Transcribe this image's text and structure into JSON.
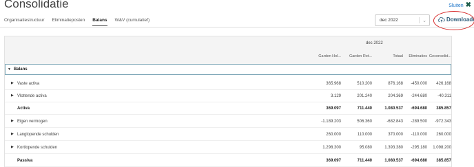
{
  "page": {
    "title": "Consolidatie",
    "close_label": "Sluiten",
    "close_icon": "close-x-icon"
  },
  "tabs": [
    {
      "label": "Organisatiestructuur",
      "active": false
    },
    {
      "label": "Eliminatieposten",
      "active": false
    },
    {
      "label": "Balans",
      "active": true
    },
    {
      "label": "W&V (cumulatief)",
      "active": false
    }
  ],
  "period_select": {
    "value": "dec 2022"
  },
  "download": {
    "label": "Downloaden",
    "icon": "cloud-upload-icon"
  },
  "table": {
    "period_header": "dec 2022",
    "columns": [
      "Garden Hol...",
      "Garden Ret...",
      "Totaal",
      "Eliminaties",
      "Geconsolid..."
    ],
    "group_label": "Balans",
    "rows": [
      {
        "label": "Vaste activa",
        "values": [
          "365.968",
          "510.200",
          "876.168",
          "-450.000",
          "426.168"
        ],
        "expandable": true,
        "total": false
      },
      {
        "label": "Vlottende activa",
        "values": [
          "3.129",
          "201.240",
          "204.369",
          "-244.680",
          "-40.311"
        ],
        "expandable": true,
        "total": false
      },
      {
        "label": "Activa",
        "values": [
          "369.097",
          "711.440",
          "1.080.537",
          "-694.680",
          "385.857"
        ],
        "expandable": false,
        "total": true
      },
      {
        "label": "Eigen vermogen",
        "values": [
          "-1.189.203",
          "506.360",
          "-682.843",
          "-289.500",
          "-972.343"
        ],
        "expandable": true,
        "total": false
      },
      {
        "label": "Langlopende schulden",
        "values": [
          "260.000",
          "110.000",
          "370.000",
          "-110.000",
          "260.000"
        ],
        "expandable": true,
        "total": false
      },
      {
        "label": "Kortlopende schulden",
        "values": [
          "1.298.300",
          "95.080",
          "1.393.380",
          "-295.180",
          "1.098.200"
        ],
        "expandable": true,
        "total": false
      },
      {
        "label": "Passiva",
        "values": [
          "369.097",
          "711.440",
          "1.080.537",
          "-694.680",
          "385.857"
        ],
        "expandable": false,
        "total": true
      }
    ]
  },
  "colors": {
    "accent": "#2b5a78",
    "highlight": "#d62828",
    "group_border": "#7fa8b8"
  }
}
